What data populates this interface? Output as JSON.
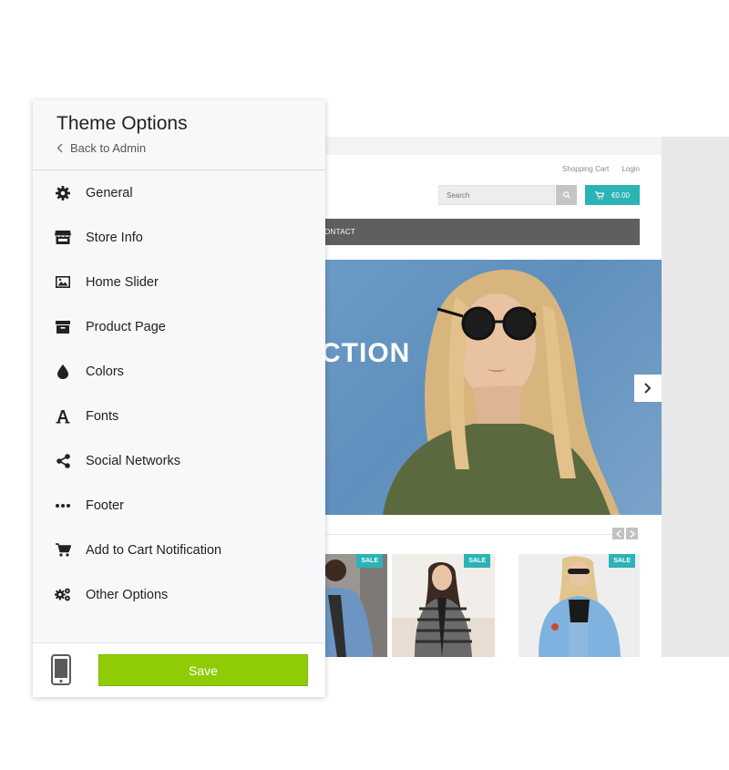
{
  "panel": {
    "title": "Theme Options",
    "back_label": "Back to Admin",
    "menu": [
      {
        "icon": "gear-icon",
        "label": "General"
      },
      {
        "icon": "store-icon",
        "label": "Store Info"
      },
      {
        "icon": "image-icon",
        "label": "Home Slider"
      },
      {
        "icon": "archive-box-icon",
        "label": "Product Page"
      },
      {
        "icon": "drop-icon",
        "label": "Colors"
      },
      {
        "icon": "font-icon",
        "label": "Fonts"
      },
      {
        "icon": "share-icon",
        "label": "Social Networks"
      },
      {
        "icon": "ellipsis-icon",
        "label": "Footer"
      },
      {
        "icon": "cart-icon",
        "label": "Add to Cart Notification"
      },
      {
        "icon": "gears-icon",
        "label": "Other Options"
      }
    ],
    "save_label": "Save",
    "device_icon": "mobile-device-icon"
  },
  "preview": {
    "links": [
      "Shopping Cart",
      "Login"
    ],
    "search_placeholder": "Search",
    "cart_total": "€0.00",
    "nav_item": "ONTACT",
    "hero_text": "CTION",
    "products": [
      {
        "badge": "SALE"
      },
      {
        "badge": "SALE"
      },
      {
        "badge": "SALE"
      }
    ]
  },
  "colors": {
    "accent_teal": "#2bb3b5",
    "save_green": "#8fcc06",
    "nav_gray": "#5f5f5f"
  }
}
